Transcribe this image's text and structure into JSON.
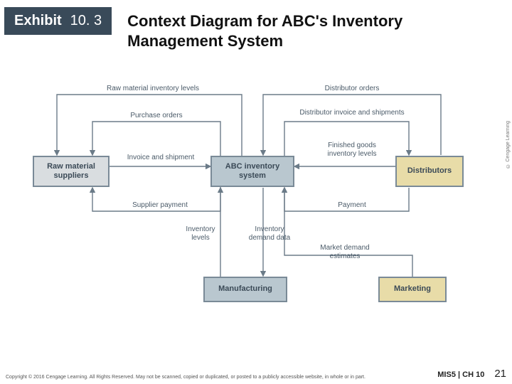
{
  "header": {
    "exhibit_label": "Exhibit",
    "exhibit_number": "10. 3",
    "title": "Context Diagram for ABC's Inventory Management System"
  },
  "entities": {
    "suppliers": "Raw material suppliers",
    "abc": "ABC inventory system",
    "distributors": "Distributors",
    "manufacturing": "Manufacturing",
    "marketing": "Marketing"
  },
  "flows": {
    "raw_inv_levels": "Raw material inventory levels",
    "purchase_orders": "Purchase orders",
    "invoice_shipment": "Invoice and shipment",
    "supplier_payment": "Supplier payment",
    "distributor_orders": "Distributor orders",
    "distributor_invoice": "Distributor invoice and shipments",
    "finished_goods": "Finished goods inventory levels",
    "payment": "Payment",
    "inventory_levels": "Inventory levels",
    "inventory_demand": "Inventory demand data",
    "market_demand": "Market demand estimates"
  },
  "footer": {
    "copyright": "Copyright © 2016 Cengage Learning. All Rights Reserved. May not be scanned, copied or duplicated, or posted to a publicly accessible website, in whole or in part.",
    "course": "MIS5 | CH 10",
    "page": "21",
    "credit": "© Cengage Learning"
  }
}
